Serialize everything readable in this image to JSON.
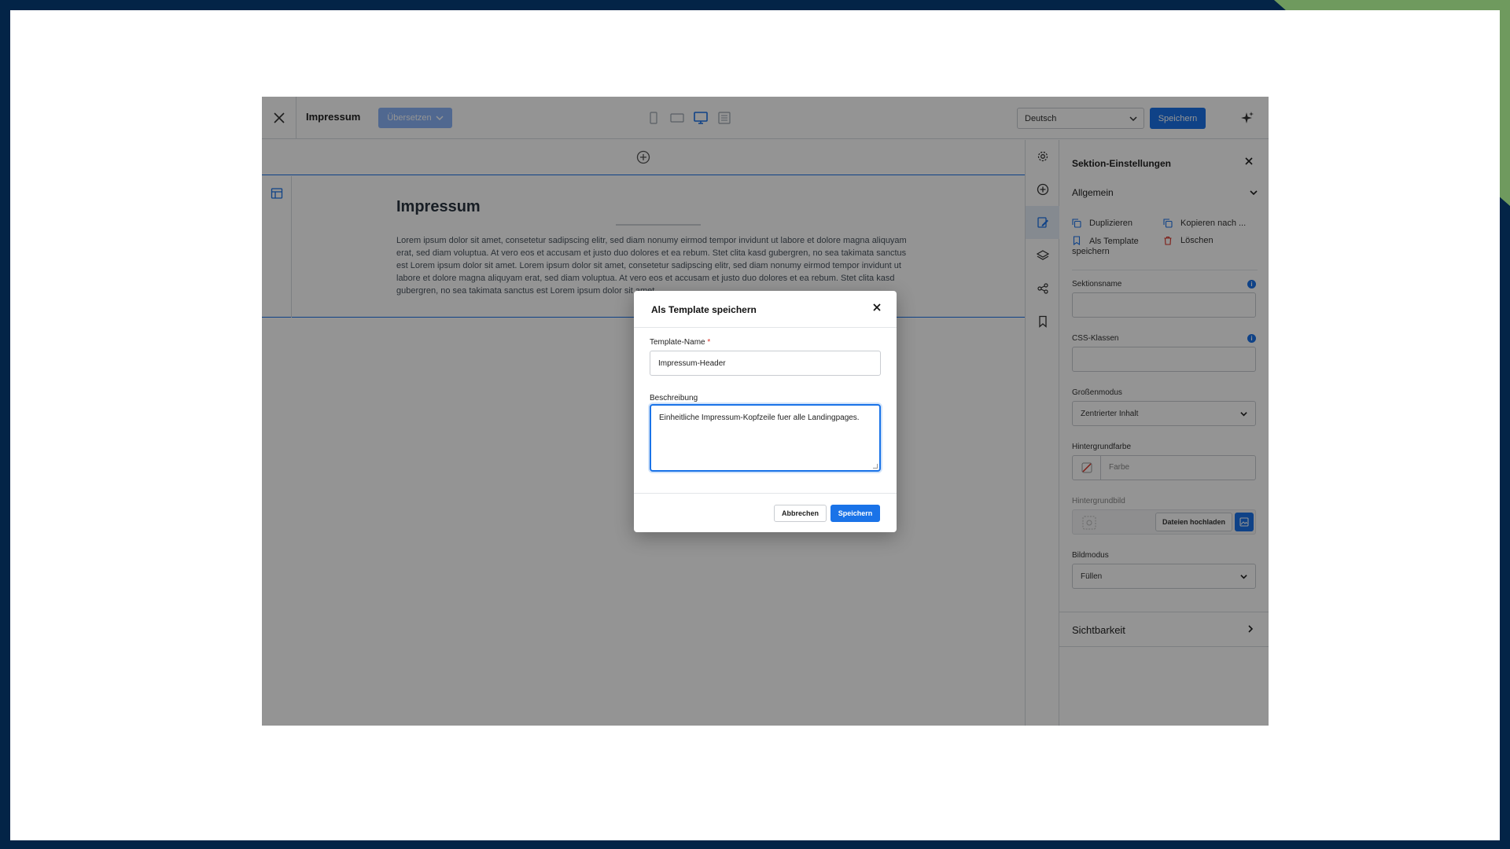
{
  "colors": {
    "accent": "#1a73e8",
    "danger": "#d93025",
    "background_navy": "#032447",
    "background_green": "#6f9a5e"
  },
  "topbar": {
    "close_icon": "close-icon",
    "page_name": "Impressum",
    "translate_label": "Übersetzen",
    "devices": [
      "phone-icon",
      "tablet-icon",
      "desktop-icon",
      "list-icon"
    ],
    "active_device": "desktop-icon",
    "language": "Deutsch",
    "save_label": "Speichern",
    "ai_icon": "sparkle-icon"
  },
  "canvas": {
    "add_icon": "add-circle-icon",
    "section": {
      "title": "Impressum",
      "text": "Lorem ipsum dolor sit amet, consetetur sadipscing elitr, sed diam nonumy eirmod tempor invidunt ut labore et dolore magna aliquyam erat, sed diam voluptua. At vero eos et accusam et justo duo dolores et ea rebum. Stet clita kasd gubergren, no sea takimata sanctus est Lorem ipsum dolor sit amet. Lorem ipsum dolor sit amet, consetetur sadipscing elitr, sed diam nonumy eirmod tempor invidunt ut labore et dolore magna aliquyam erat, sed diam voluptua. At vero eos et accusam et justo duo dolores et ea rebum. Stet clita kasd gubergren, no sea takimata sanctus est Lorem ipsum dolor sit amet."
    }
  },
  "rail": [
    "gear-icon",
    "add-circle-icon",
    "edit-icon",
    "layers-icon",
    "share-icon",
    "bookmark-icon"
  ],
  "panel": {
    "title": "Sektion-Einstellungen",
    "general_label": "Allgemein",
    "actions": {
      "duplicate": "Duplizieren",
      "copy_to": "Kopieren nach ...",
      "save_template_line1": "Als Template",
      "save_template_line2": "speichern",
      "delete": "Löschen"
    },
    "section_name_label": "Sektionsname",
    "section_name_value": "",
    "css_classes_label": "CSS-Klassen",
    "css_classes_value": "",
    "size_mode_label": "Großenmodus",
    "size_mode_value": "Zentrierter Inhalt",
    "bg_color_label": "Hintergrundfarbe",
    "bg_color_placeholder": "Farbe",
    "bg_image_label": "Hintergrundbild",
    "upload_label": "Dateien hochladen",
    "image_mode_label": "Bildmodus",
    "image_mode_value": "Füllen",
    "visibility_label": "Sichtbarkeit"
  },
  "modal": {
    "title": "Als Template speichern",
    "name_label": "Template-Name",
    "required_mark": "*",
    "name_value": "Impressum-Header",
    "description_label": "Beschreibung",
    "description_value": "Einheitliche Impressum-Kopfzeile fuer alle Landingpages.",
    "cancel_label": "Abbrechen",
    "save_label": "Speichern"
  }
}
